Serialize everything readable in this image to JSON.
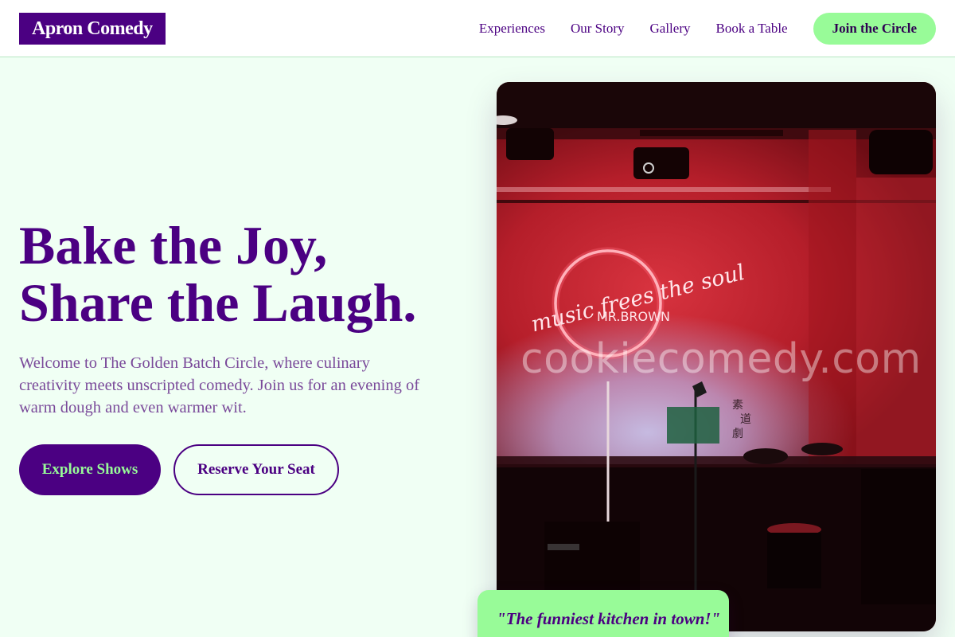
{
  "header": {
    "logo": "Apron Comedy",
    "nav": [
      {
        "label": "Experiences"
      },
      {
        "label": "Our Story"
      },
      {
        "label": "Gallery"
      },
      {
        "label": "Book a Table"
      }
    ],
    "cta_label": "Join the Circle"
  },
  "hero": {
    "title_line1": "Bake the Joy,",
    "title_line2": "Share the Laugh.",
    "description": "Welcome to The Golden Batch Circle, where culinary creativity meets unscripted comedy. Join us for an evening of warm dough and even warmer wit.",
    "primary_button": "Explore Shows",
    "secondary_button": "Reserve Your Seat"
  },
  "image": {
    "neon_line1": "music frees the soul",
    "neon_line2": "MR.BROWN",
    "watermark": "cookiecomedy.com"
  },
  "quote": "\"The funniest kitchen in town!\"",
  "colors": {
    "brand_purple": "#4b0082",
    "mint": "#98fb98",
    "page_bg": "#f0fff4"
  }
}
